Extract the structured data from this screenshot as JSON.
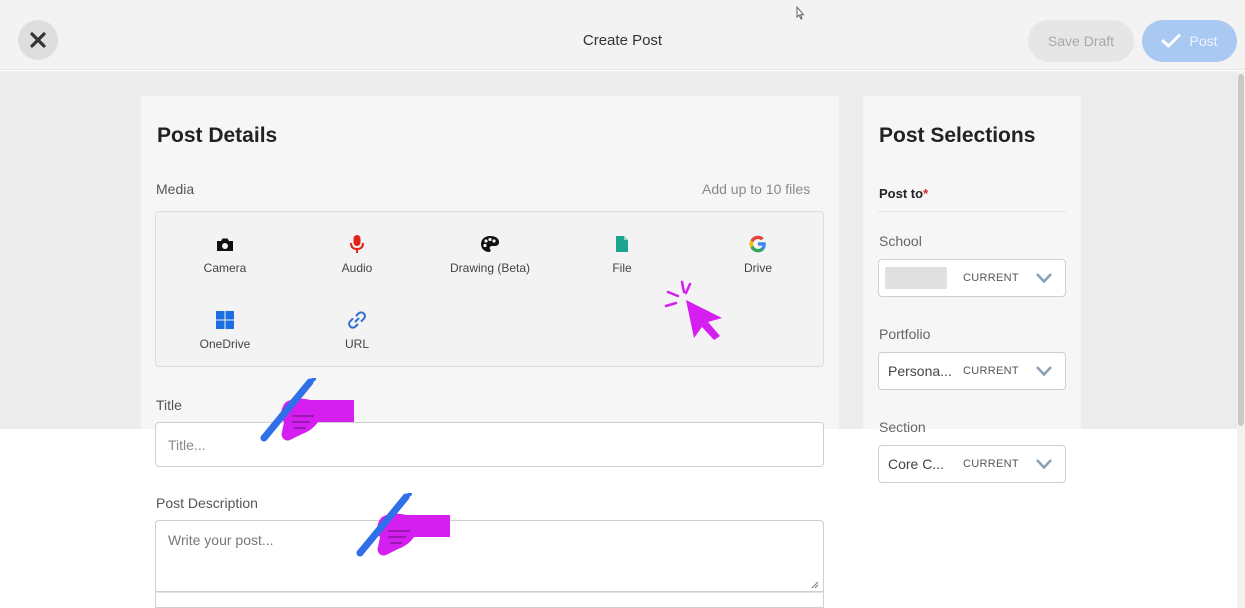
{
  "header": {
    "title": "Create Post",
    "save_draft_label": "Save Draft",
    "post_label": "Post"
  },
  "details": {
    "title": "Post Details",
    "media_label": "Media",
    "media_hint": "Add up to 10 files",
    "media_items": [
      {
        "label": "Camera",
        "icon": "camera-icon"
      },
      {
        "label": "Audio",
        "icon": "microphone-icon"
      },
      {
        "label": "Drawing (Beta)",
        "icon": "palette-icon"
      },
      {
        "label": "File",
        "icon": "file-icon"
      },
      {
        "label": "Drive",
        "icon": "google-drive-icon"
      },
      {
        "label": "OneDrive",
        "icon": "onedrive-icon"
      },
      {
        "label": "URL",
        "icon": "link-icon"
      }
    ],
    "title_label": "Title",
    "title_placeholder": "Title...",
    "description_label": "Post Description",
    "description_placeholder": "Write your post..."
  },
  "selections": {
    "title": "Post Selections",
    "post_to_label": "Post to",
    "required_mark": "*",
    "school_label": "School",
    "school_current": "CURRENT",
    "portfolio_label": "Portfolio",
    "portfolio_value": "Persona...",
    "portfolio_current": "CURRENT",
    "section_label": "Section",
    "section_value": "Core C...",
    "section_current": "CURRENT"
  },
  "colors": {
    "post_button": "#a9c8f2",
    "audio_icon": "#e2231a",
    "file_icon": "#1aa38e",
    "onedrive_icon": "#1b6fe0",
    "link_icon": "#2f6fd6",
    "annotation_magenta": "#d51ef0",
    "annotation_pen": "#2f6fe8"
  }
}
